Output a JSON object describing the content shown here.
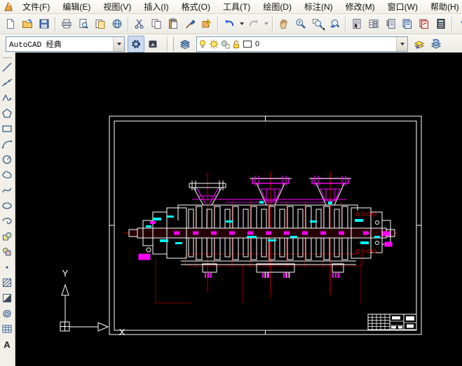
{
  "menubar": {
    "items": [
      "文件(F)",
      "编辑(E)",
      "视图(V)",
      "插入(I)",
      "格式(O)",
      "工具(T)",
      "绘图(D)",
      "标注(N)",
      "修改(M)",
      "窗口(W)",
      "帮助(H)"
    ]
  },
  "workspace_toolbar": {
    "selected_workspace": "AutoCAD 经典"
  },
  "layer_toolbar": {
    "current_layer": "0"
  },
  "glyphs": {
    "help": "?",
    "mtext": "A",
    "zoom_plus": "±"
  },
  "ucs": {
    "y_label": "Y",
    "x_label": "X"
  },
  "canvas_colors": {
    "background": "#000000",
    "outline": "#ffffff",
    "accent_magenta": "#ff00ff",
    "accent_red": "#c40000",
    "centerline_dark_red": "#7e0000",
    "accent_cyan": "#00ffff"
  }
}
